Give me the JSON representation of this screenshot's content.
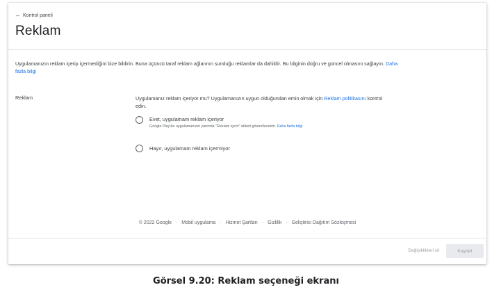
{
  "header": {
    "back_label": "Kontrol paneli",
    "title": "Reklam"
  },
  "intro": {
    "text": "Uygulamanızın reklam içerip içermediğini bize bildirin. Buna üçüncü taraf reklam ağlarının sunduğu reklamlar da dahildir. Bu bilginin doğru ve güncel olmasını sağlayın.",
    "link": "Daha fazla bilgi"
  },
  "ads_section": {
    "label": "Reklam",
    "question_pre": "Uygulamanız reklam içeriyor mu? Uygulamanızın uygun olduğundan emin olmak için",
    "question_link": "Reklam politikasını",
    "question_post": "kontrol edin.",
    "options": [
      {
        "label": "Evet, uygulamam reklam içeriyor",
        "help": "Google Play'de uygulamanızın yanında \"Reklam içerir\" etiketi gösterilecektir.",
        "help_link": "Daha fazla bilgi",
        "selected": false
      },
      {
        "label": "Hayır, uygulamam reklam içermiyor",
        "selected": false
      }
    ]
  },
  "footer": {
    "copyright": "© 2022 Google",
    "links": [
      "Mobil uygulama",
      "Hizmet Şartları",
      "Gizlilik",
      "Geliştirici Dağıtım Sözleşmesi"
    ]
  },
  "actions": {
    "discard_label": "Değişiklikleri sil",
    "save_label": "Kaydet"
  },
  "caption": "Görsel 9.20: Reklam seçeneği ekranı",
  "colors": {
    "link": "#1a73e8",
    "text": "#3c4043",
    "disabled": "#9aa0a6",
    "disabled_bg": "#e8eaed"
  }
}
